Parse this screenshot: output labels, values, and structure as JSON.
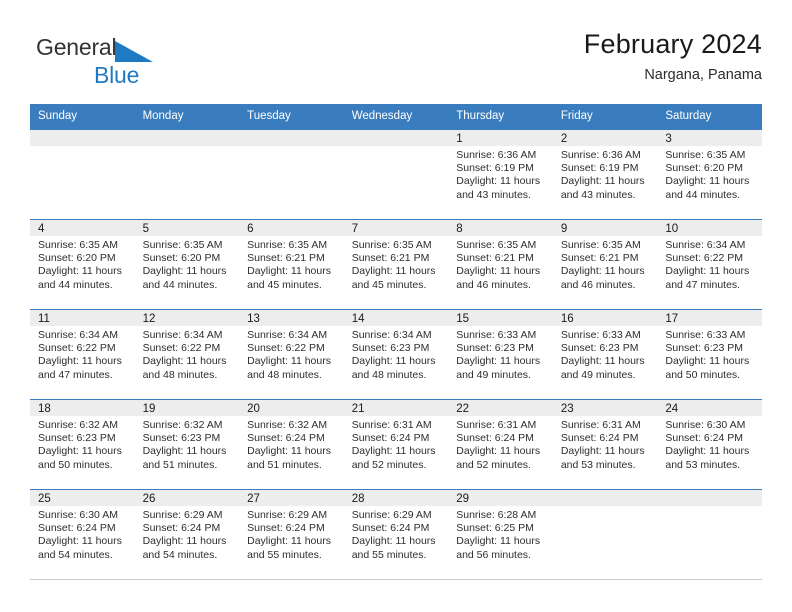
{
  "brand": {
    "word1": "General",
    "word2": "Blue",
    "triangle_color": "#1f7ac4"
  },
  "header": {
    "title": "February 2024",
    "location": "Nargana, Panama"
  },
  "theme": {
    "header_bg": "#3a7dbf",
    "header_text": "#ffffff",
    "daynum_band_bg": "#ededed",
    "row_border": "#3a7dbf",
    "body_text": "#2e2e2e"
  },
  "labels": {
    "sunrise": "Sunrise:",
    "sunset": "Sunset:",
    "daylight": "Daylight:"
  },
  "weekdays": [
    "Sunday",
    "Monday",
    "Tuesday",
    "Wednesday",
    "Thursday",
    "Friday",
    "Saturday"
  ],
  "weeks": [
    [
      {
        "day": "",
        "empty": true
      },
      {
        "day": "",
        "empty": true
      },
      {
        "day": "",
        "empty": true
      },
      {
        "day": "",
        "empty": true
      },
      {
        "day": "1",
        "sunrise": "Sunrise: 6:36 AM",
        "sunset": "Sunset: 6:19 PM",
        "daylight": "Daylight: 11 hours and 43 minutes."
      },
      {
        "day": "2",
        "sunrise": "Sunrise: 6:36 AM",
        "sunset": "Sunset: 6:19 PM",
        "daylight": "Daylight: 11 hours and 43 minutes."
      },
      {
        "day": "3",
        "sunrise": "Sunrise: 6:35 AM",
        "sunset": "Sunset: 6:20 PM",
        "daylight": "Daylight: 11 hours and 44 minutes."
      }
    ],
    [
      {
        "day": "4",
        "sunrise": "Sunrise: 6:35 AM",
        "sunset": "Sunset: 6:20 PM",
        "daylight": "Daylight: 11 hours and 44 minutes."
      },
      {
        "day": "5",
        "sunrise": "Sunrise: 6:35 AM",
        "sunset": "Sunset: 6:20 PM",
        "daylight": "Daylight: 11 hours and 44 minutes."
      },
      {
        "day": "6",
        "sunrise": "Sunrise: 6:35 AM",
        "sunset": "Sunset: 6:21 PM",
        "daylight": "Daylight: 11 hours and 45 minutes."
      },
      {
        "day": "7",
        "sunrise": "Sunrise: 6:35 AM",
        "sunset": "Sunset: 6:21 PM",
        "daylight": "Daylight: 11 hours and 45 minutes."
      },
      {
        "day": "8",
        "sunrise": "Sunrise: 6:35 AM",
        "sunset": "Sunset: 6:21 PM",
        "daylight": "Daylight: 11 hours and 46 minutes."
      },
      {
        "day": "9",
        "sunrise": "Sunrise: 6:35 AM",
        "sunset": "Sunset: 6:21 PM",
        "daylight": "Daylight: 11 hours and 46 minutes."
      },
      {
        "day": "10",
        "sunrise": "Sunrise: 6:34 AM",
        "sunset": "Sunset: 6:22 PM",
        "daylight": "Daylight: 11 hours and 47 minutes."
      }
    ],
    [
      {
        "day": "11",
        "sunrise": "Sunrise: 6:34 AM",
        "sunset": "Sunset: 6:22 PM",
        "daylight": "Daylight: 11 hours and 47 minutes."
      },
      {
        "day": "12",
        "sunrise": "Sunrise: 6:34 AM",
        "sunset": "Sunset: 6:22 PM",
        "daylight": "Daylight: 11 hours and 48 minutes."
      },
      {
        "day": "13",
        "sunrise": "Sunrise: 6:34 AM",
        "sunset": "Sunset: 6:22 PM",
        "daylight": "Daylight: 11 hours and 48 minutes."
      },
      {
        "day": "14",
        "sunrise": "Sunrise: 6:34 AM",
        "sunset": "Sunset: 6:23 PM",
        "daylight": "Daylight: 11 hours and 48 minutes."
      },
      {
        "day": "15",
        "sunrise": "Sunrise: 6:33 AM",
        "sunset": "Sunset: 6:23 PM",
        "daylight": "Daylight: 11 hours and 49 minutes."
      },
      {
        "day": "16",
        "sunrise": "Sunrise: 6:33 AM",
        "sunset": "Sunset: 6:23 PM",
        "daylight": "Daylight: 11 hours and 49 minutes."
      },
      {
        "day": "17",
        "sunrise": "Sunrise: 6:33 AM",
        "sunset": "Sunset: 6:23 PM",
        "daylight": "Daylight: 11 hours and 50 minutes."
      }
    ],
    [
      {
        "day": "18",
        "sunrise": "Sunrise: 6:32 AM",
        "sunset": "Sunset: 6:23 PM",
        "daylight": "Daylight: 11 hours and 50 minutes."
      },
      {
        "day": "19",
        "sunrise": "Sunrise: 6:32 AM",
        "sunset": "Sunset: 6:23 PM",
        "daylight": "Daylight: 11 hours and 51 minutes."
      },
      {
        "day": "20",
        "sunrise": "Sunrise: 6:32 AM",
        "sunset": "Sunset: 6:24 PM",
        "daylight": "Daylight: 11 hours and 51 minutes."
      },
      {
        "day": "21",
        "sunrise": "Sunrise: 6:31 AM",
        "sunset": "Sunset: 6:24 PM",
        "daylight": "Daylight: 11 hours and 52 minutes."
      },
      {
        "day": "22",
        "sunrise": "Sunrise: 6:31 AM",
        "sunset": "Sunset: 6:24 PM",
        "daylight": "Daylight: 11 hours and 52 minutes."
      },
      {
        "day": "23",
        "sunrise": "Sunrise: 6:31 AM",
        "sunset": "Sunset: 6:24 PM",
        "daylight": "Daylight: 11 hours and 53 minutes."
      },
      {
        "day": "24",
        "sunrise": "Sunrise: 6:30 AM",
        "sunset": "Sunset: 6:24 PM",
        "daylight": "Daylight: 11 hours and 53 minutes."
      }
    ],
    [
      {
        "day": "25",
        "sunrise": "Sunrise: 6:30 AM",
        "sunset": "Sunset: 6:24 PM",
        "daylight": "Daylight: 11 hours and 54 minutes."
      },
      {
        "day": "26",
        "sunrise": "Sunrise: 6:29 AM",
        "sunset": "Sunset: 6:24 PM",
        "daylight": "Daylight: 11 hours and 54 minutes."
      },
      {
        "day": "27",
        "sunrise": "Sunrise: 6:29 AM",
        "sunset": "Sunset: 6:24 PM",
        "daylight": "Daylight: 11 hours and 55 minutes."
      },
      {
        "day": "28",
        "sunrise": "Sunrise: 6:29 AM",
        "sunset": "Sunset: 6:24 PM",
        "daylight": "Daylight: 11 hours and 55 minutes."
      },
      {
        "day": "29",
        "sunrise": "Sunrise: 6:28 AM",
        "sunset": "Sunset: 6:25 PM",
        "daylight": "Daylight: 11 hours and 56 minutes."
      },
      {
        "day": "",
        "empty": true
      },
      {
        "day": "",
        "empty": true
      }
    ]
  ]
}
